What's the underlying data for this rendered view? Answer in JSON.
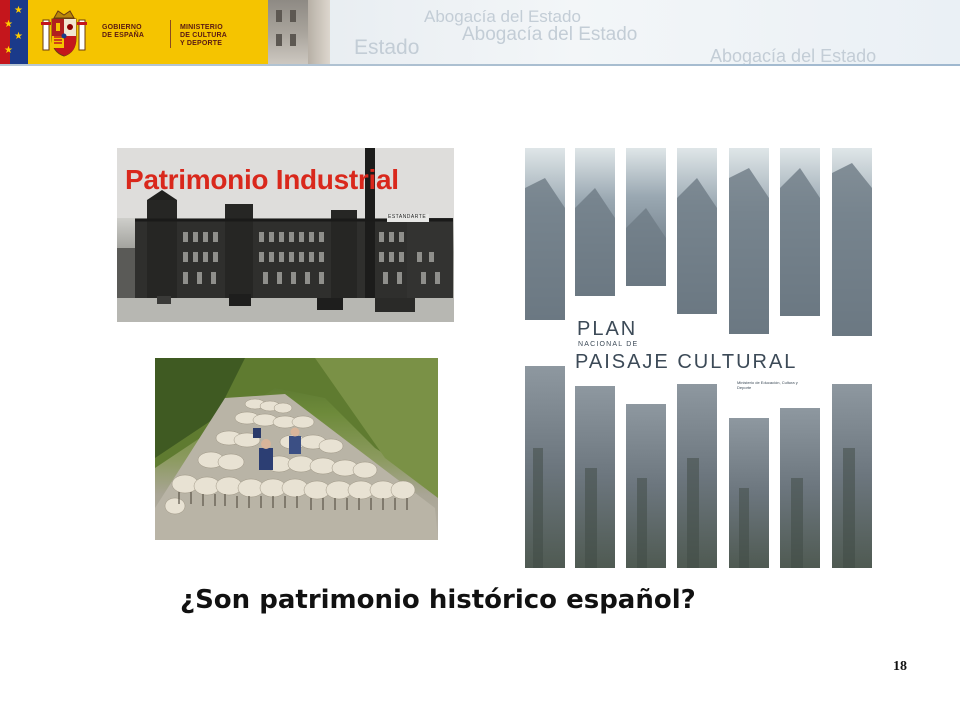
{
  "header": {
    "gov_lines": [
      "GOBIERNO",
      "DE ESPAÑA"
    ],
    "ministry_lines": [
      "MINISTERIO",
      "DE CULTURA",
      "Y DEPORTE"
    ],
    "watermarks": [
      "Abogacía del Estado",
      "Abogacía del Estado",
      "Estado",
      "Abogacía del Estado"
    ],
    "colors": {
      "gov_yellow": "#f5c400",
      "eu_blue": "#1b3a8a",
      "spain_red": "#c4161c"
    }
  },
  "images": {
    "industrial": {
      "title": "Patrimonio Industrial",
      "sign": "ESTANDARTE"
    },
    "sheep": {},
    "poster": {
      "title_line1": "PLAN",
      "subtitle": "NACIONAL DE",
      "title_line2": "PAISAJE CULTURAL",
      "publisher": "Ministerio de Educación, Cultura y Deporte"
    }
  },
  "question": "¿Son patrimonio histórico español?",
  "page_number": "18",
  "colors": {
    "title_red": "#d9281c",
    "text_dark": "#111111"
  }
}
